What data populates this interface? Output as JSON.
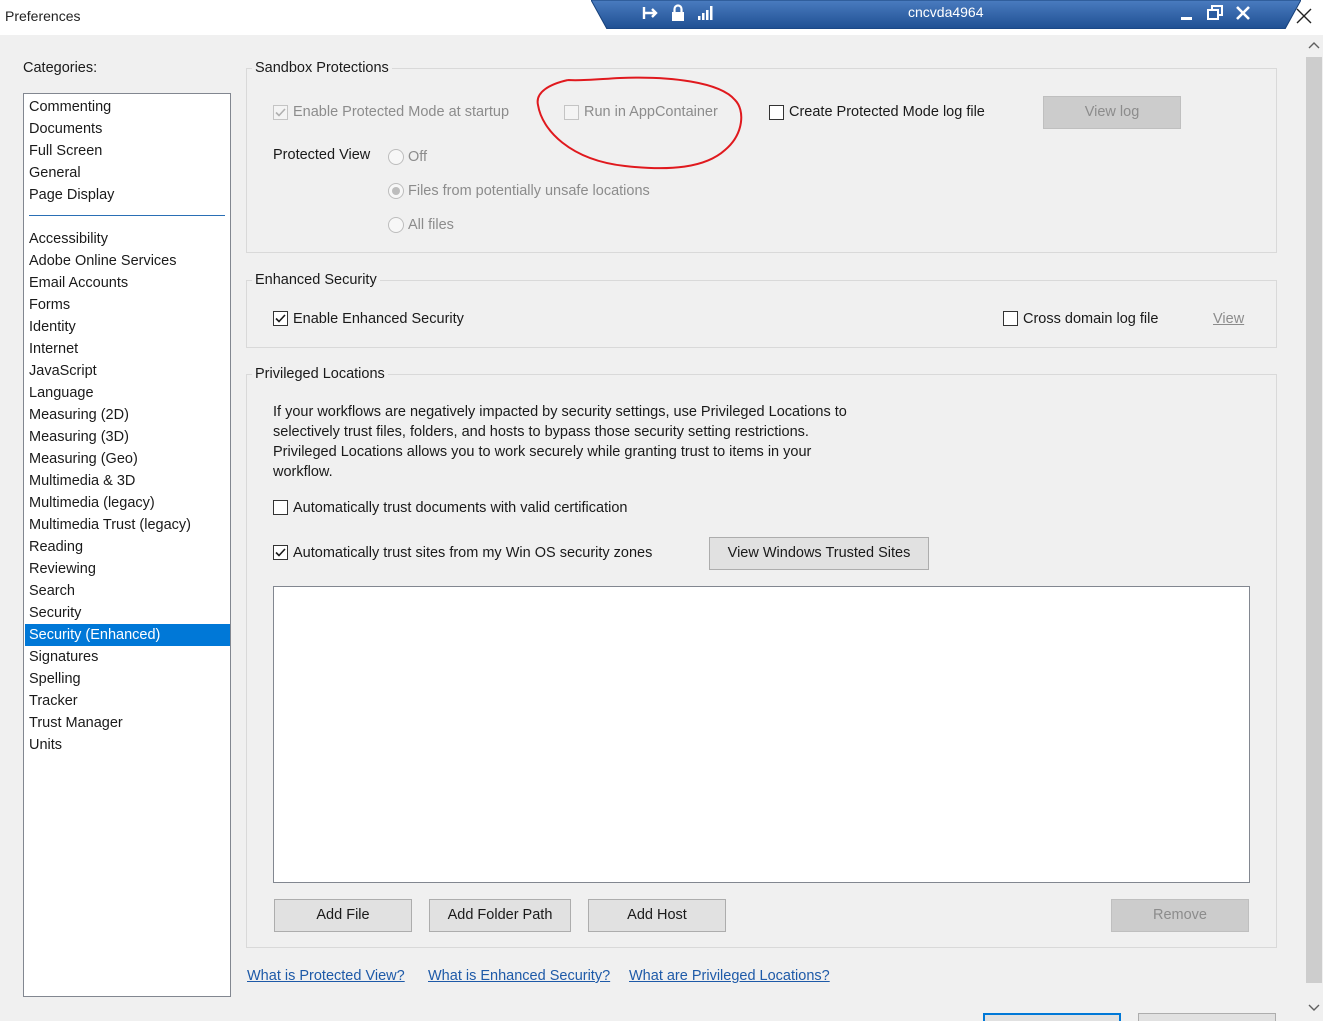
{
  "window": {
    "title": "Preferences",
    "host_name": "cncvda4964",
    "accent_color": "#2d63a8",
    "icons": [
      "pin-icon",
      "lock-icon",
      "signal-icon",
      "minimize-icon",
      "restore-icon",
      "close-icon"
    ]
  },
  "categories": {
    "label": "Categories:",
    "group1": [
      "Commenting",
      "Documents",
      "Full Screen",
      "General",
      "Page Display"
    ],
    "group2": [
      "Accessibility",
      "Adobe Online Services",
      "Email Accounts",
      "Forms",
      "Identity",
      "Internet",
      "JavaScript",
      "Language",
      "Measuring (2D)",
      "Measuring (3D)",
      "Measuring (Geo)",
      "Multimedia & 3D",
      "Multimedia (legacy)",
      "Multimedia Trust (legacy)",
      "Reading",
      "Reviewing",
      "Search",
      "Security",
      "Security (Enhanced)",
      "Signatures",
      "Spelling",
      "Tracker",
      "Trust Manager",
      "Units"
    ],
    "selected": "Security (Enhanced)",
    "selected_color": "#0078d7"
  },
  "sandbox": {
    "title": "Sandbox Protections",
    "enable_protected_mode": {
      "label": "Enable Protected Mode at startup",
      "checked": true,
      "enabled": false
    },
    "run_in_appcontainer": {
      "label": "Run in AppContainer",
      "checked": false,
      "enabled": false
    },
    "create_log": {
      "label": "Create Protected Mode log file",
      "checked": false,
      "enabled": true
    },
    "view_log_label": "View log",
    "protected_view_label": "Protected View",
    "protected_view_options": [
      {
        "label": "Off",
        "selected": false
      },
      {
        "label": "Files from potentially unsafe locations",
        "selected": true
      },
      {
        "label": "All files",
        "selected": false
      }
    ]
  },
  "enhanced": {
    "title": "Enhanced Security",
    "enable_enhanced": {
      "label": "Enable Enhanced Security",
      "checked": true
    },
    "cross_domain": {
      "label": "Cross domain log file",
      "checked": false
    },
    "view_label": "View"
  },
  "privileged": {
    "title": "Privileged Locations",
    "description": "If your workflows are negatively impacted by security settings, use Privileged Locations to selectively trust files, folders, and hosts to bypass those security setting restrictions. Privileged Locations allows you to work securely while granting trust to items in your workflow.",
    "auto_trust_cert": {
      "label": "Automatically trust documents with valid certification",
      "checked": false
    },
    "auto_trust_sites": {
      "label": "Automatically trust sites from my Win OS security zones",
      "checked": true
    },
    "view_trusted_sites_label": "View Windows Trusted Sites",
    "list_items": [],
    "add_file_label": "Add File",
    "add_folder_label": "Add Folder Path",
    "add_host_label": "Add Host",
    "remove_label": "Remove"
  },
  "help_links": {
    "protected_view": "What is Protected View?",
    "enhanced_security": "What is Enhanced Security?",
    "privileged_locations": "What are Privileged Locations?"
  },
  "annotation_color": "#e0191e"
}
